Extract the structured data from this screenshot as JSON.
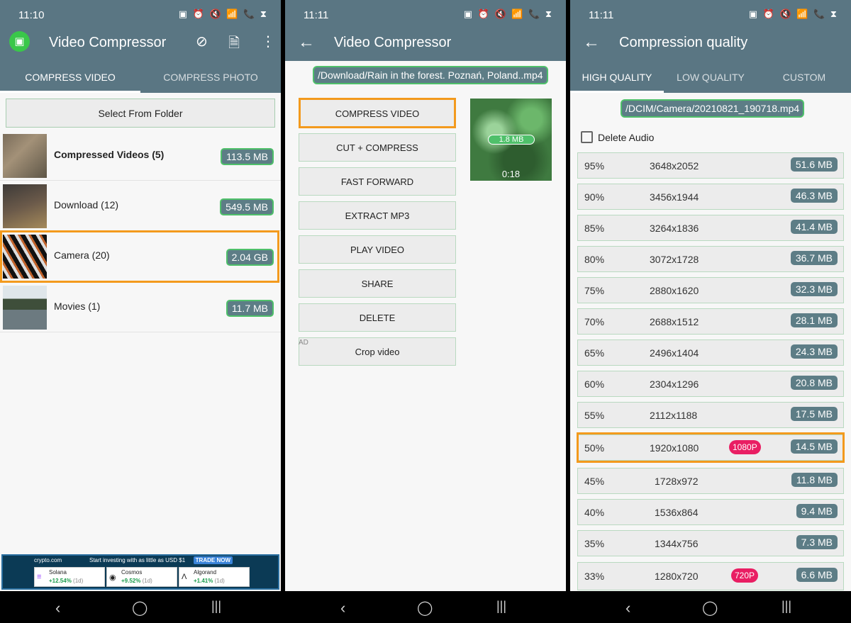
{
  "screen1": {
    "time": "11:10",
    "status_icons": "▣ ⏰ 🔇 📶 📞 ⧗",
    "title": "Video Compressor",
    "tabs": [
      {
        "label": "COMPRESS VIDEO"
      },
      {
        "label": "COMPRESS PHOTO"
      }
    ],
    "select_folder": "Select From Folder",
    "folders": [
      {
        "label": "Compressed Videos (5)",
        "size": "113.5 MB"
      },
      {
        "label": "Download (12)",
        "size": "549.5 MB"
      },
      {
        "label": "Camera (20)",
        "size": "2.04 GB"
      },
      {
        "label": "Movies (1)",
        "size": "11.7 MB"
      }
    ],
    "ad": {
      "brand": "crypto.com",
      "headline": "Start investing with as little as USD $1",
      "cta": "TRADE NOW",
      "coins": [
        {
          "name": "Solana",
          "change": "+12.54%",
          "period": "(1d)"
        },
        {
          "name": "Cosmos",
          "change": "+9.52%",
          "period": "(1d)"
        },
        {
          "name": "Algorand",
          "change": "+1.41%",
          "period": "(1d)"
        }
      ]
    }
  },
  "screen2": {
    "time": "11:11",
    "title": "Video Compressor",
    "path": "/Download/Rain in the forest. Poznań, Poland..mp4",
    "buttons": [
      "COMPRESS VIDEO",
      "CUT + COMPRESS",
      "FAST FORWARD",
      "EXTRACT MP3",
      "PLAY VIDEO",
      "SHARE",
      "DELETE",
      "Crop video"
    ],
    "ad_tag": "AD",
    "preview": {
      "size": "1.8 MB",
      "duration": "0:18"
    }
  },
  "screen3": {
    "time": "11:11",
    "title": "Compression quality",
    "tabs": [
      {
        "label": "HIGH QUALITY"
      },
      {
        "label": "LOW QUALITY"
      },
      {
        "label": "CUSTOM"
      }
    ],
    "path": "/DCIM/Camera/20210821_190718.mp4",
    "delete_audio": "Delete Audio",
    "qualities": [
      {
        "pct": "95%",
        "res": "3648x2052",
        "size": "51.6 MB",
        "badge": ""
      },
      {
        "pct": "90%",
        "res": "3456x1944",
        "size": "46.3 MB",
        "badge": ""
      },
      {
        "pct": "85%",
        "res": "3264x1836",
        "size": "41.4 MB",
        "badge": ""
      },
      {
        "pct": "80%",
        "res": "3072x1728",
        "size": "36.7 MB",
        "badge": ""
      },
      {
        "pct": "75%",
        "res": "2880x1620",
        "size": "32.3 MB",
        "badge": ""
      },
      {
        "pct": "70%",
        "res": "2688x1512",
        "size": "28.1 MB",
        "badge": ""
      },
      {
        "pct": "65%",
        "res": "2496x1404",
        "size": "24.3 MB",
        "badge": ""
      },
      {
        "pct": "60%",
        "res": "2304x1296",
        "size": "20.8 MB",
        "badge": ""
      },
      {
        "pct": "55%",
        "res": "2112x1188",
        "size": "17.5 MB",
        "badge": ""
      },
      {
        "pct": "50%",
        "res": "1920x1080",
        "size": "14.5 MB",
        "badge": "1080P"
      },
      {
        "pct": "45%",
        "res": "1728x972",
        "size": "11.8 MB",
        "badge": ""
      },
      {
        "pct": "40%",
        "res": "1536x864",
        "size": "9.4 MB",
        "badge": ""
      },
      {
        "pct": "35%",
        "res": "1344x756",
        "size": "7.3 MB",
        "badge": ""
      },
      {
        "pct": "33%",
        "res": "1280x720",
        "size": "6.6 MB",
        "badge": "720P"
      }
    ]
  },
  "navbar": {
    "back": "‹",
    "home": "◯",
    "recents": "|||"
  },
  "colors": {
    "appbar": "#5a7683",
    "accent": "#4fc06a",
    "highlight": "#f39a1d",
    "badge": "#e91e63"
  }
}
